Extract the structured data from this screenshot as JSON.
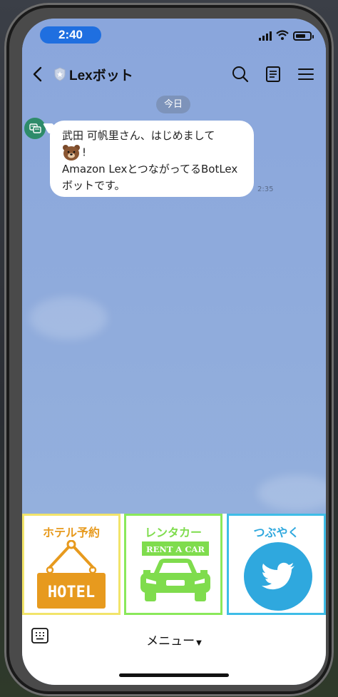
{
  "status_bar": {
    "time": "2:40"
  },
  "header": {
    "title": "Lexボット"
  },
  "chat": {
    "date_label": "今日",
    "messages": [
      {
        "line1": "武田 可帆里さん、はじめまして",
        "line2_suffix": "!",
        "line3": "Amazon LexとつながってるBotLex",
        "line4": "ボットです。",
        "time": "2:35"
      }
    ]
  },
  "rich_menu": {
    "hotel": {
      "title": "ホテル予約",
      "sign": "HOTEL",
      "title_color": "#e79a1e"
    },
    "car": {
      "title": "レンタカー",
      "sign": "RENT A CAR",
      "title_color": "#7fdc4d"
    },
    "twitter": {
      "title": "つぶやく",
      "title_color": "#2fa8de"
    }
  },
  "bottom_bar": {
    "menu_label": "メニュー"
  }
}
